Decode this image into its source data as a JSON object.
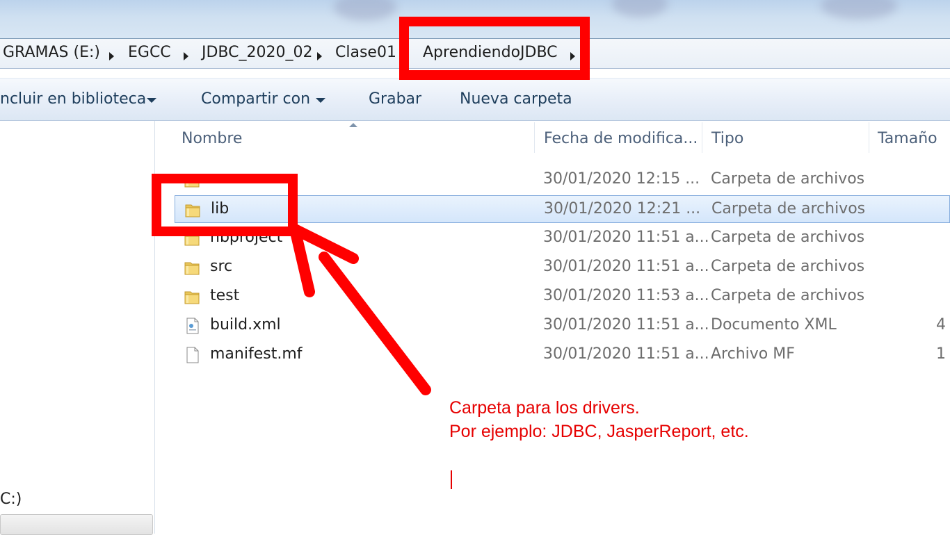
{
  "address": {
    "crumbs": [
      "GRAMAS (E:)",
      "EGCC",
      "JDBC_2020_02",
      "Clase01",
      "AprendiendoJDBC"
    ]
  },
  "toolbar": {
    "include_library": "ncluir en biblioteca",
    "share_with": "Compartir con",
    "burn": "Grabar",
    "new_folder": "Nueva carpeta"
  },
  "nav": {
    "drive_label": "C:)"
  },
  "columns": {
    "name": "Nombre",
    "date": "Fecha de modifica...",
    "type": "Tipo",
    "size": "Tamaño"
  },
  "files": [
    {
      "name": "",
      "date": "30/01/2020 12:15 ...",
      "type": "Carpeta de archivos",
      "size": "",
      "icon": "folder-icon"
    },
    {
      "name": "lib",
      "date": "30/01/2020 12:21 ...",
      "type": "Carpeta de archivos",
      "size": "",
      "icon": "folder-icon",
      "selected": true
    },
    {
      "name": "nbproject",
      "date": "30/01/2020 11:51 a...",
      "type": "Carpeta de archivos",
      "size": "",
      "icon": "folder-icon"
    },
    {
      "name": "src",
      "date": "30/01/2020 11:51 a...",
      "type": "Carpeta de archivos",
      "size": "",
      "icon": "folder-icon"
    },
    {
      "name": "test",
      "date": "30/01/2020 11:53 a...",
      "type": "Carpeta de archivos",
      "size": "",
      "icon": "folder-icon"
    },
    {
      "name": "build.xml",
      "date": "30/01/2020 11:51 a...",
      "type": "Documento XML",
      "size": "4",
      "icon": "xml-file-icon"
    },
    {
      "name": "manifest.mf",
      "date": "30/01/2020 11:51 a...",
      "type": "Archivo MF",
      "size": "1",
      "icon": "blank-file-icon"
    }
  ],
  "annotation": {
    "line1": "Carpeta para los drivers.",
    "line2": "Por ejemplo: JDBC, JasperReport, etc.",
    "color": "#ff0000"
  }
}
